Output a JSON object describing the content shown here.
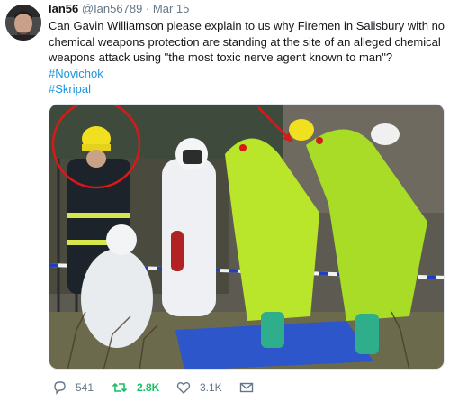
{
  "tweet": {
    "display_name": "Ian56",
    "handle": "@Ian56789",
    "separator": "·",
    "date": "Mar 15",
    "text_lines": [
      "Can Gavin Williamson please explain to us why Firemen in Salisbury with no",
      "chemical weapons protection are standing at the site of an alleged chemical",
      "weapons attack using \"the most toxic nerve agent known to man\"?"
    ],
    "hashtags": [
      "#Novichok",
      "#Skripal"
    ]
  },
  "actions": {
    "reply_count": "541",
    "retweet_count": "2.8K",
    "like_count": "3.1K"
  },
  "icons": {
    "reply": "reply-icon",
    "retweet": "retweet-icon",
    "like": "heart-icon",
    "dm": "envelope-icon"
  },
  "colors": {
    "hashtag": "#1b95e0",
    "retweet_active": "#17bf63",
    "meta": "#657786",
    "hazmat_suit": "#b9e62a",
    "circle_annotation": "#d61a1a"
  }
}
